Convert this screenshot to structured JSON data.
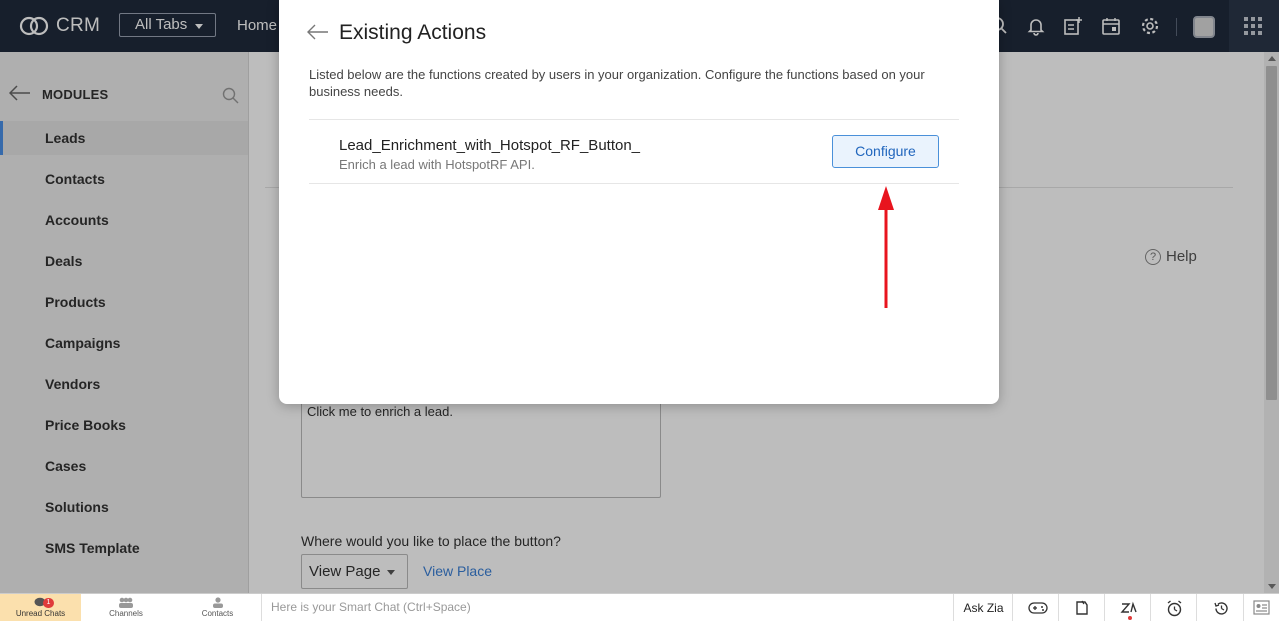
{
  "topbar": {
    "app_name": "CRM",
    "all_tabs_label": "All Tabs",
    "home_tab": "Home",
    "icons": [
      "search-icon",
      "bell-icon",
      "add-note-icon",
      "calendar-icon",
      "gear-icon",
      "avatar",
      "app-grid-icon"
    ]
  },
  "sidebar": {
    "title": "MODULES",
    "items": [
      {
        "label": "Leads",
        "active": true
      },
      {
        "label": "Contacts"
      },
      {
        "label": "Accounts"
      },
      {
        "label": "Deals"
      },
      {
        "label": "Products"
      },
      {
        "label": "Campaigns"
      },
      {
        "label": "Vendors"
      },
      {
        "label": "Price Books"
      },
      {
        "label": "Cases"
      },
      {
        "label": "Solutions"
      },
      {
        "label": "SMS Template"
      }
    ]
  },
  "background": {
    "help_label": "Help",
    "help_glyph": "?",
    "textarea_value": "Click me to enrich a lead.",
    "placement_question": "Where would you like to place the button?",
    "placement_select": "View Page",
    "view_place_link": "View Place"
  },
  "modal": {
    "title": "Existing Actions",
    "description": "Listed below are the functions created by users in your organization. Configure the functions based on your business needs.",
    "functions": [
      {
        "name": "Lead_Enrichment_with_Hotspot_RF_Button_",
        "description": "Enrich a lead with HotspotRF API.",
        "action_label": "Configure"
      }
    ]
  },
  "bottombar": {
    "unread_chats_label": "Unread Chats",
    "unread_count": "1",
    "channels_label": "Channels",
    "contacts_label": "Contacts",
    "smart_chat_placeholder": "Here is your Smart Chat (Ctrl+Space)",
    "ask_zia_label": "Ask Zia"
  },
  "colors": {
    "topbar_bg": "#1f2a3c",
    "accent": "#4a90d9",
    "annotation_arrow": "#e8141e",
    "unread_bg": "#fbe0ad"
  }
}
